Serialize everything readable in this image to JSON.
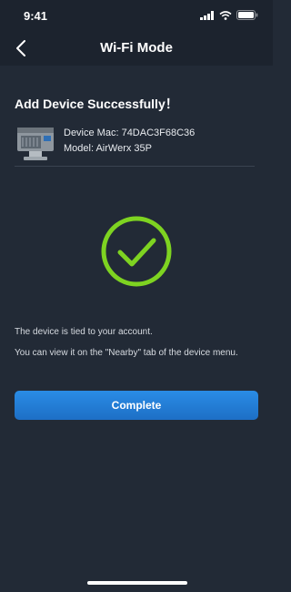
{
  "status_bar": {
    "time": "9:41",
    "icons": [
      "signal-icon",
      "wifi-icon",
      "battery-icon"
    ]
  },
  "header": {
    "title": "Wi-Fi Mode",
    "back_icon": "chevron-left-icon"
  },
  "main": {
    "heading": "Add Device Successfully！",
    "device": {
      "mac_line": "Device Mac: 74DAC3F68C36",
      "model_line": "Model: AirWerx 35P"
    },
    "status_icon": "success-check-icon",
    "messages": [
      "The device is tied to your account.",
      "You can view it on the \"Nearby\" tab of the device menu."
    ],
    "complete_label": "Complete"
  },
  "colors": {
    "background": "#222a36",
    "bar": "#1c232e",
    "accent_green": "#7ed321",
    "button_blue": "#2178d6"
  }
}
